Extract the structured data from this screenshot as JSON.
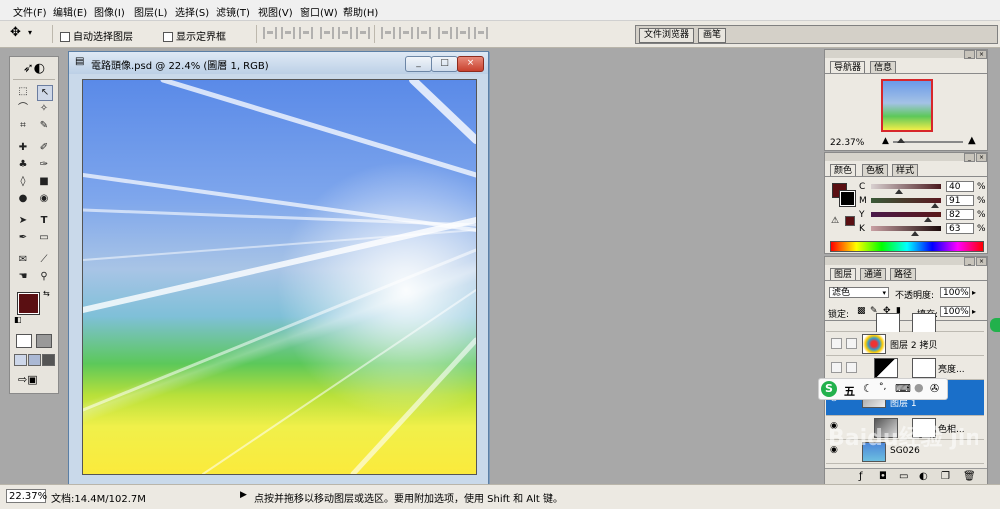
{
  "menu": [
    "文件(F)",
    "编辑(E)",
    "图像(I)",
    "图层(L)",
    "选择(S)",
    "滤镜(T)",
    "视图(V)",
    "窗口(W)",
    "帮助(H)"
  ],
  "options": {
    "auto_select": "自动选择图层",
    "show_bounds": "显示定界框"
  },
  "well_tabs": [
    "文件浏览器",
    "画笔"
  ],
  "document": {
    "title": "電路頭像.psd @ 22.4% (圖層 1, RGB)",
    "controls": [
      "_",
      "□",
      "×"
    ]
  },
  "navigator": {
    "tabs": [
      "导航器",
      "信息"
    ],
    "zoom": "22.37%"
  },
  "color": {
    "tabs": [
      "颜色",
      "色板",
      "样式"
    ],
    "channels": [
      {
        "label": "C",
        "value": "40",
        "unit": "%",
        "level": 0.4
      },
      {
        "label": "M",
        "value": "91",
        "unit": "%",
        "level": 0.91
      },
      {
        "label": "Y",
        "value": "82",
        "unit": "%",
        "level": 0.82
      },
      {
        "label": "K",
        "value": "63",
        "unit": "%",
        "level": 0.63
      }
    ],
    "foreground": "#5a0f12",
    "background": "#000000"
  },
  "layers": {
    "tabs": [
      "图层",
      "通道",
      "路径"
    ],
    "blend_mode": "滤色",
    "opacity_label": "不透明度:",
    "opacity": "100%",
    "lock_label": "锁定:",
    "fill_label": "填充:",
    "fill": "100%",
    "items": [
      {
        "name": "图层 2 拷贝",
        "selected": false
      },
      {
        "name": "亮度...",
        "selected": false
      },
      {
        "name": "图层 1",
        "selected": true
      },
      {
        "name": "色相...",
        "selected": false
      },
      {
        "name": "SG026",
        "selected": false
      }
    ]
  },
  "ime_bar": {
    "label": "五"
  },
  "status": {
    "zoom": "22.37%",
    "doc_label": "文档:14.4M/102.7M",
    "hint": "点按并拖移以移动图层或选区。要用附加选项，使用 Shift 和 Alt 键。"
  },
  "watermark": "Baidu经验 jingyan.baidu.com"
}
